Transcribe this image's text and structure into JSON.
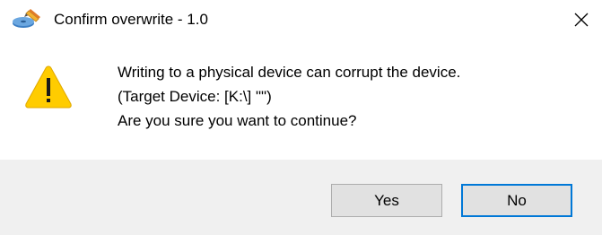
{
  "window": {
    "title": "Confirm overwrite - 1.0",
    "icon": "disk-writer-app-icon"
  },
  "close_icon": "close-icon",
  "message": {
    "icon": "warning-icon",
    "lines": [
      "Writing to a physical device can corrupt the device.",
      "(Target Device: [K:\\] \"\")",
      "Are you sure you want to continue?"
    ]
  },
  "buttons": {
    "yes_label": "Yes",
    "no_label": "No"
  },
  "colors": {
    "footer_background": "#f0f0f0",
    "button_background": "#e1e1e1",
    "button_border": "#adadad",
    "focus_border": "#0078d7",
    "warning_yellow": "#ffcc00"
  }
}
